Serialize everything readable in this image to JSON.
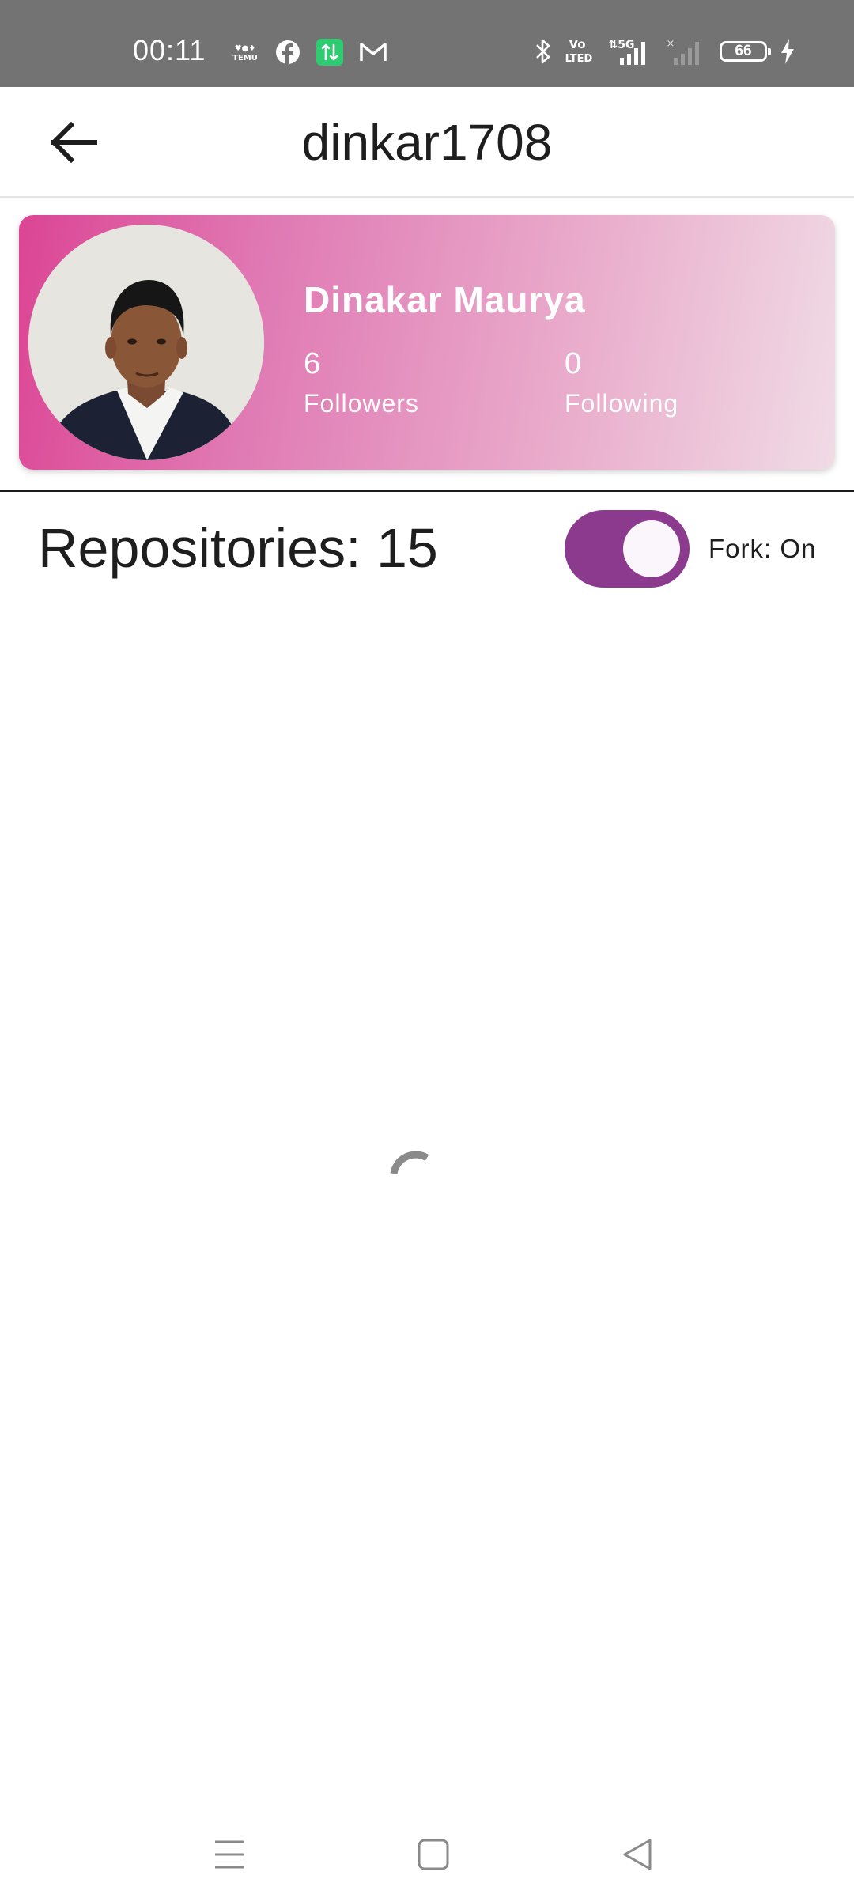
{
  "status_bar": {
    "time": "00:11",
    "left_icons": [
      "temu-icon",
      "facebook-icon",
      "data-transfer-icon",
      "gmail-icon"
    ],
    "right_icons": [
      "bluetooth-icon",
      "volte-icon",
      "5g-signal-icon",
      "no-signal-icon",
      "battery-icon",
      "charging-icon"
    ],
    "volte_label": "Vo\nLTED",
    "network_label": "5G",
    "battery_level": "66"
  },
  "app_bar": {
    "back_icon": "arrow-back-icon",
    "title": "dinkar1708"
  },
  "profile": {
    "name": "Dinakar Maurya",
    "followers_count": "6",
    "followers_label": "Followers",
    "following_count": "0",
    "following_label": "Following",
    "gradient_colors": [
      "#dc4594",
      "#e07ab4",
      "#e9a9ca",
      "#f0dbe5"
    ]
  },
  "repositories": {
    "label": "Repositories: 15",
    "fork_toggle_on": true,
    "fork_label": "Fork: On",
    "toggle_color": "#8c3a8d"
  },
  "loading": {
    "spinner_color": "#8a8a8a"
  },
  "nav_bar": {
    "icons": [
      "menu-icon",
      "home-square-icon",
      "back-triangle-icon"
    ]
  }
}
